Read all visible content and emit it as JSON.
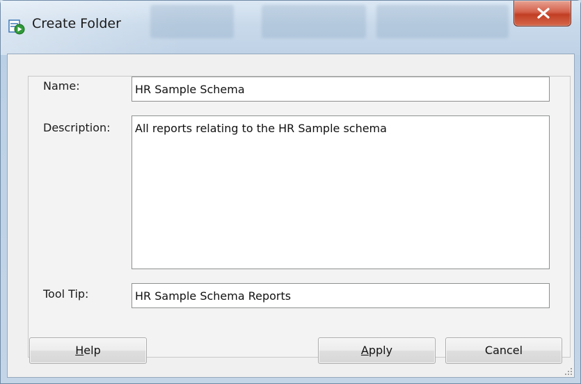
{
  "window": {
    "title": "Create Folder",
    "icon": "folder-run-icon",
    "close_icon": "close-icon",
    "close_color": "#c8452b"
  },
  "form": {
    "name_label": "Name:",
    "name_value": "HR Sample Schema",
    "description_label": "Description:",
    "description_value": "All reports relating to the HR Sample schema",
    "tooltip_label": "Tool Tip:",
    "tooltip_value": "HR Sample Schema Reports"
  },
  "buttons": {
    "help": {
      "mnemonic": "H",
      "rest": "elp"
    },
    "apply": {
      "mnemonic": "A",
      "rest": "pply"
    },
    "cancel": {
      "label": "Cancel"
    }
  }
}
